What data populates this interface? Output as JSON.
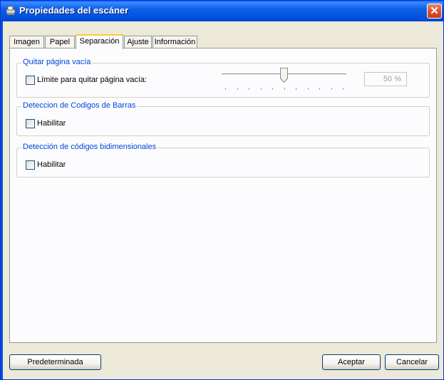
{
  "window": {
    "title": "Propiedades del escáner",
    "close_glyph": "✕"
  },
  "tabs": [
    {
      "label": "Imagen"
    },
    {
      "label": "Papel"
    },
    {
      "label": "Separación"
    },
    {
      "label": "Ajuste"
    },
    {
      "label": "Información"
    }
  ],
  "active_tab": "Separación",
  "groups": {
    "blank_page": {
      "title": "Quitar página vacía",
      "checkbox_label": "Límite para quitar página vacía:",
      "checked": false,
      "slider_value_percent": 50,
      "value_text": "50 %"
    },
    "barcode": {
      "title": "Deteccion de Codigos de Barras",
      "checkbox_label": "Habilitar",
      "checked": false
    },
    "two_d_codes": {
      "title": "Detección de códigos bidimensionales",
      "checkbox_label": "Habilitar",
      "checked": false
    }
  },
  "buttons": {
    "default": "Predeterminada",
    "ok": "Aceptar",
    "cancel": "Cancelar"
  },
  "colors": {
    "title_bar": "#0054e3",
    "group_title": "#0046d5",
    "active_tab_highlight": "#ffc83c",
    "close_button": "#d64c23"
  },
  "icons": {
    "title": "scanner-icon",
    "close": "close-icon"
  }
}
